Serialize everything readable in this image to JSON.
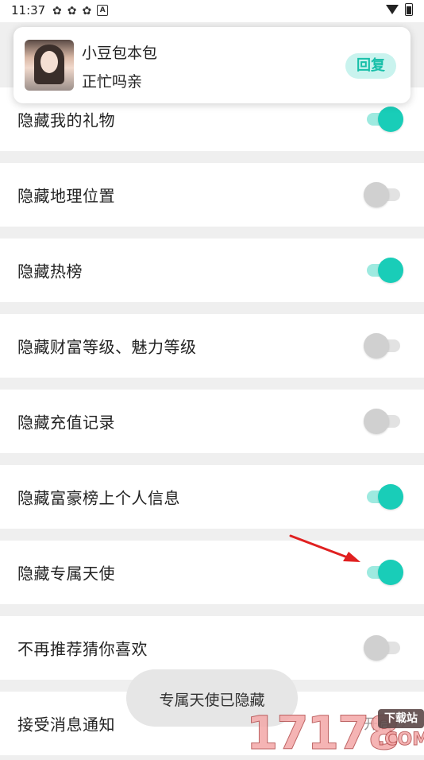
{
  "status_bar": {
    "time": "11:37",
    "icons": [
      "app-icon",
      "app-icon",
      "app-icon",
      "a-icon",
      "wifi-icon",
      "battery-icon"
    ]
  },
  "notification": {
    "sender": "小豆包本包",
    "message": "正忙吗亲",
    "reply_label": "回复"
  },
  "settings": [
    {
      "label": "隐藏我的礼物",
      "on": true
    },
    {
      "label": "隐藏地理位置",
      "on": false
    },
    {
      "label": "隐藏热榜",
      "on": true
    },
    {
      "label": "隐藏财富等级、魅力等级",
      "on": false
    },
    {
      "label": "隐藏充值记录",
      "on": false
    },
    {
      "label": "隐藏富豪榜上个人信息",
      "on": true
    },
    {
      "label": "隐藏专属天使",
      "on": true
    },
    {
      "label": "不再推荐猜你喜欢",
      "on": false
    },
    {
      "label": "接受消息通知",
      "value": "开启"
    }
  ],
  "toast": "专属天使已隐藏",
  "watermark": {
    "digits": "17178",
    "site": "下载站",
    "suffix": ".COM"
  },
  "colors": {
    "accent": "#19cdb8",
    "accent_track": "#9eeae0",
    "off_thumb": "#d0d0d0",
    "off_track": "#e2e2e2",
    "annotation_arrow": "#e02020"
  }
}
